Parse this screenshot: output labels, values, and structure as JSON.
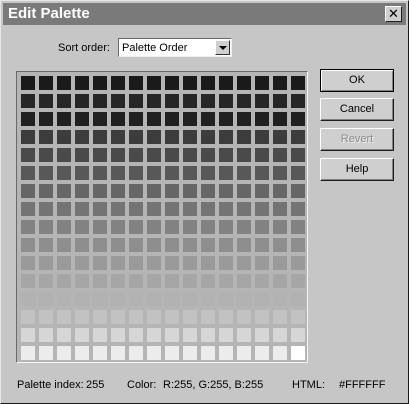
{
  "window": {
    "title": "Edit Palette",
    "close_glyph": "✕"
  },
  "sort": {
    "label": "Sort order:",
    "value": "Palette Order"
  },
  "palette": {
    "rows": 16,
    "cols": 16,
    "row_grays": [
      "#1a1a1a",
      "#262626",
      "#202020",
      "#3c3c3c",
      "#4a4a4a",
      "#585858",
      "#666666",
      "#747474",
      "#828282",
      "#8e8e8e",
      "#9a9a9a",
      "#a6a6a6",
      "#b2b2b2",
      "#c2c2c2",
      "#d6d6d6",
      "#ececec"
    ],
    "selected_index": 255
  },
  "buttons": {
    "ok": "OK",
    "cancel": "Cancel",
    "revert": "Revert",
    "help": "Help"
  },
  "status": {
    "index_label": "Palette index:",
    "index_value": "255",
    "color_label": "Color:",
    "color_value": "R:255, G:255, B:255",
    "html_label": "HTML:",
    "html_value": "#FFFFFF"
  }
}
